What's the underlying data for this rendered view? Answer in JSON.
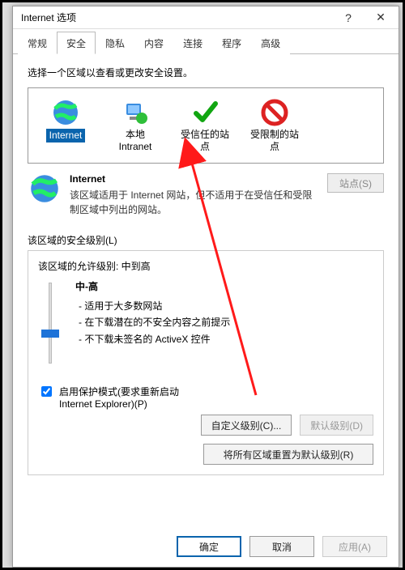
{
  "window": {
    "title": "Internet 选项",
    "help": "?",
    "close": "✕"
  },
  "tabs": {
    "general": "常规",
    "security": "安全",
    "privacy": "隐私",
    "content": "内容",
    "connections": "连接",
    "programs": "程序",
    "advanced": "高级"
  },
  "instruction": "选择一个区域以查看或更改安全设置。",
  "zones": {
    "internet": "Internet",
    "intranet_l1": "本地",
    "intranet_l2": "Intranet",
    "trusted_l1": "受信任的站",
    "trusted_l2": "点",
    "restricted_l1": "受限制的站",
    "restricted_l2": "点"
  },
  "zone_desc": {
    "title": "Internet",
    "text": "该区域适用于 Internet 网站，但不适用于在受信任和受限制区域中列出的网站。",
    "sites_btn": "站点(S)"
  },
  "security": {
    "label": "该区域的安全级别(L)",
    "allowed": "该区域的允许级别: 中到高",
    "level_name": "中-高",
    "b1": "- 适用于大多数网站",
    "b2": "- 在下载潜在的不安全内容之前提示",
    "b3": "- 不下载未签名的 ActiveX 控件"
  },
  "protected": {
    "label_l1": "启用保护模式(要求重新启动",
    "label_l2": "Internet Explorer)(P)"
  },
  "buttons": {
    "custom": "自定义级别(C)...",
    "default": "默认级别(D)",
    "reset_all": "将所有区域重置为默认级别(R)",
    "ok": "确定",
    "cancel": "取消",
    "apply": "应用(A)"
  }
}
